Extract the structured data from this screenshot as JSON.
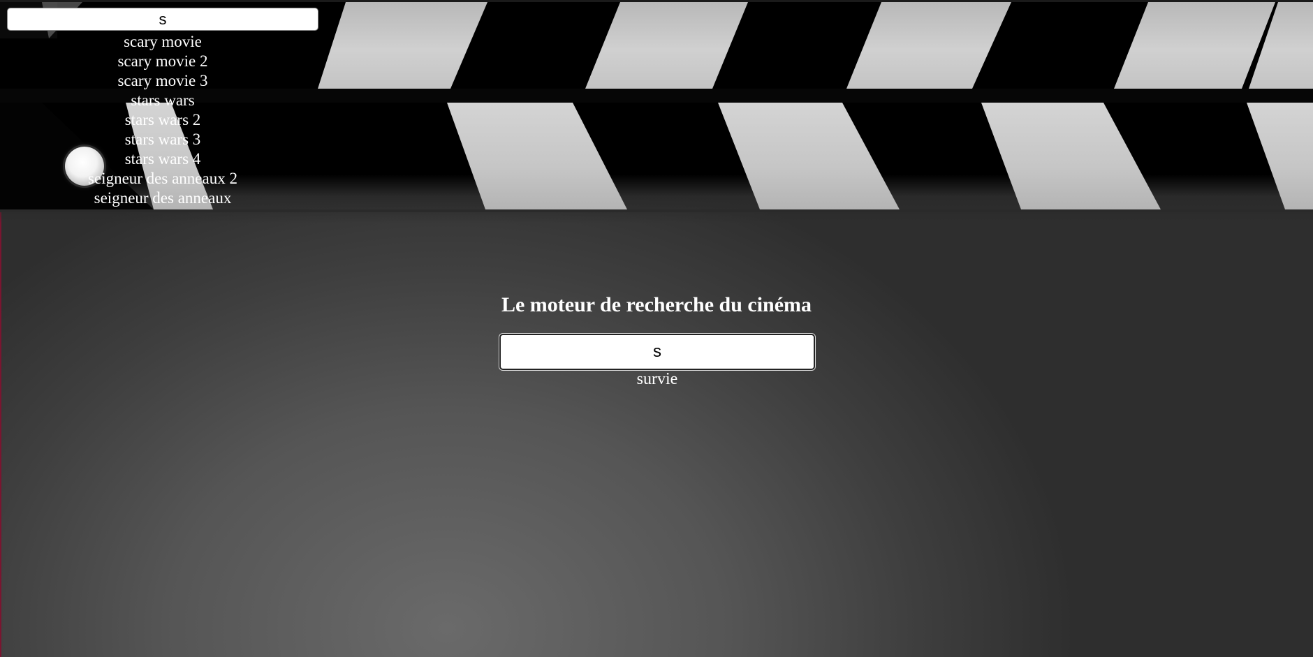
{
  "top_search": {
    "value": "s"
  },
  "top_suggestions": [
    "scary movie",
    "scary movie 2",
    "scary movie 3",
    "stars wars",
    "stars wars 2",
    "stars wars 3",
    "stars wars 4",
    "seigneur des anneaux 2",
    "seigneur des anneaux"
  ],
  "main": {
    "title": "Le moteur de recherche du cinéma",
    "search_value": "s",
    "suggestion": "survie"
  },
  "colors": {
    "stripe_light": "#c8c8c8",
    "stripe_dark": "#050505",
    "background": "#555555",
    "text": "#ffffff"
  }
}
